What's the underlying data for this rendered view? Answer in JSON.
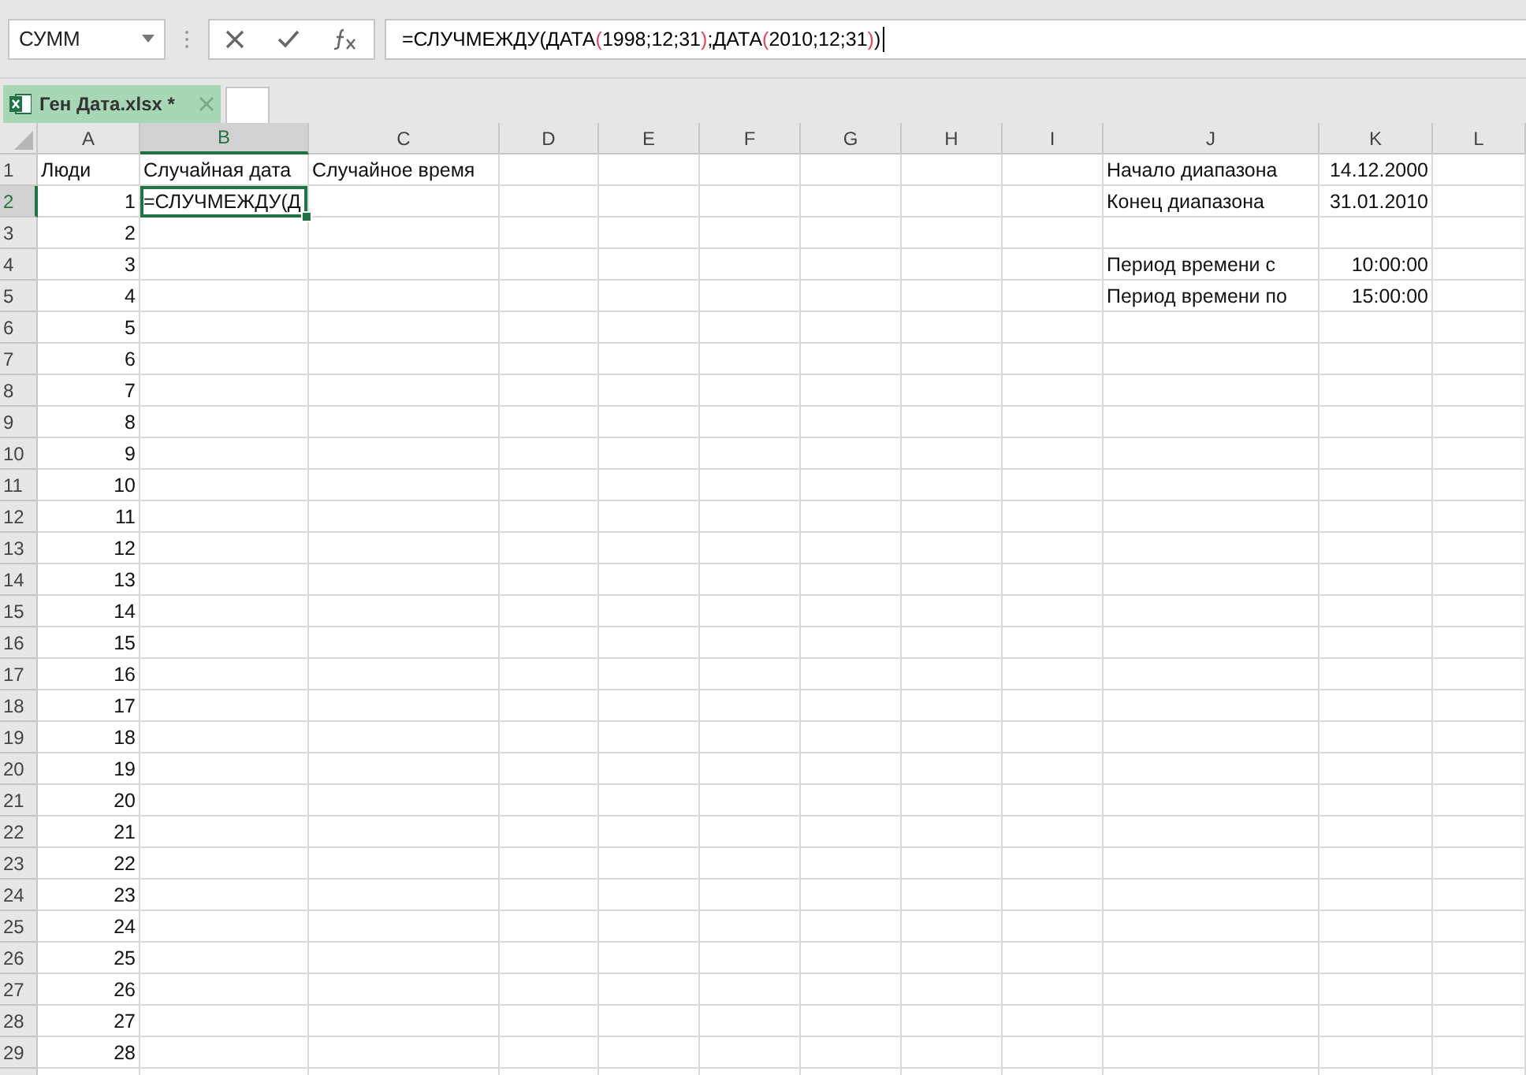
{
  "name_box": {
    "value": "СУММ"
  },
  "formula_bar": {
    "parts": [
      {
        "text": "=СЛУЧМЕЖДУ(ДАТА",
        "color": "#000000"
      },
      {
        "text": "(",
        "color": "#e0475b"
      },
      {
        "text": "1998;12;31",
        "color": "#000000"
      },
      {
        "text": ")",
        "color": "#e0475b"
      },
      {
        "text": ";ДАТА",
        "color": "#000000"
      },
      {
        "text": "(",
        "color": "#e0475b"
      },
      {
        "text": "2010;12;31",
        "color": "#000000"
      },
      {
        "text": ")",
        "color": "#e0475b"
      },
      {
        "text": ")",
        "color": "#000000"
      }
    ]
  },
  "workbook_tab": {
    "title": "Ген Дата.xlsx *"
  },
  "columns": [
    {
      "label": "A",
      "selected": false
    },
    {
      "label": "B",
      "selected": true
    },
    {
      "label": "C",
      "selected": false
    },
    {
      "label": "D",
      "selected": false
    },
    {
      "label": "E",
      "selected": false
    },
    {
      "label": "F",
      "selected": false
    },
    {
      "label": "G",
      "selected": false
    },
    {
      "label": "H",
      "selected": false
    },
    {
      "label": "I",
      "selected": false
    },
    {
      "label": "J",
      "selected": false
    },
    {
      "label": "K",
      "selected": false
    },
    {
      "label": "L",
      "selected": false
    }
  ],
  "rows": [
    {
      "number": "1",
      "selected": false,
      "cells": [
        {
          "text": "Люди",
          "kind": "text"
        },
        {
          "text": "Случайная дата",
          "kind": "text"
        },
        {
          "text": "Случайное время",
          "kind": "text"
        },
        null,
        null,
        null,
        null,
        null,
        null,
        {
          "text": "Начало диапазона",
          "kind": "text"
        },
        {
          "text": "14.12.2000",
          "kind": "number"
        }
      ]
    },
    {
      "number": "2",
      "selected": true,
      "cells": [
        {
          "text": "1",
          "kind": "number"
        },
        {
          "text": "=СЛУЧМЕЖДУ(Д",
          "kind": "text"
        },
        null,
        null,
        null,
        null,
        null,
        null,
        null,
        {
          "text": "Конец диапазона",
          "kind": "text"
        },
        {
          "text": "31.01.2010",
          "kind": "number"
        }
      ]
    },
    {
      "number": "3",
      "selected": false,
      "cells": [
        {
          "text": "2",
          "kind": "number"
        }
      ]
    },
    {
      "number": "4",
      "selected": false,
      "cells": [
        {
          "text": "3",
          "kind": "number"
        },
        null,
        null,
        null,
        null,
        null,
        null,
        null,
        null,
        {
          "text": "Период времени с",
          "kind": "text"
        },
        {
          "text": "10:00:00",
          "kind": "number"
        }
      ]
    },
    {
      "number": "5",
      "selected": false,
      "cells": [
        {
          "text": "4",
          "kind": "number"
        },
        null,
        null,
        null,
        null,
        null,
        null,
        null,
        null,
        {
          "text": "Период времени по",
          "kind": "text"
        },
        {
          "text": "15:00:00",
          "kind": "number"
        }
      ]
    },
    {
      "number": "6",
      "selected": false,
      "cells": [
        {
          "text": "5",
          "kind": "number"
        }
      ]
    },
    {
      "number": "7",
      "selected": false,
      "cells": [
        {
          "text": "6",
          "kind": "number"
        }
      ]
    },
    {
      "number": "8",
      "selected": false,
      "cells": [
        {
          "text": "7",
          "kind": "number"
        }
      ]
    },
    {
      "number": "9",
      "selected": false,
      "cells": [
        {
          "text": "8",
          "kind": "number"
        }
      ]
    },
    {
      "number": "10",
      "selected": false,
      "cells": [
        {
          "text": "9",
          "kind": "number"
        }
      ]
    },
    {
      "number": "11",
      "selected": false,
      "cells": [
        {
          "text": "10",
          "kind": "number"
        }
      ]
    },
    {
      "number": "12",
      "selected": false,
      "cells": [
        {
          "text": "11",
          "kind": "number"
        }
      ]
    },
    {
      "number": "13",
      "selected": false,
      "cells": [
        {
          "text": "12",
          "kind": "number"
        }
      ]
    },
    {
      "number": "14",
      "selected": false,
      "cells": [
        {
          "text": "13",
          "kind": "number"
        }
      ]
    },
    {
      "number": "15",
      "selected": false,
      "cells": [
        {
          "text": "14",
          "kind": "number"
        }
      ]
    },
    {
      "number": "16",
      "selected": false,
      "cells": [
        {
          "text": "15",
          "kind": "number"
        }
      ]
    },
    {
      "number": "17",
      "selected": false,
      "cells": [
        {
          "text": "16",
          "kind": "number"
        }
      ]
    },
    {
      "number": "18",
      "selected": false,
      "cells": [
        {
          "text": "17",
          "kind": "number"
        }
      ]
    },
    {
      "number": "19",
      "selected": false,
      "cells": [
        {
          "text": "18",
          "kind": "number"
        }
      ]
    },
    {
      "number": "20",
      "selected": false,
      "cells": [
        {
          "text": "19",
          "kind": "number"
        }
      ]
    },
    {
      "number": "21",
      "selected": false,
      "cells": [
        {
          "text": "20",
          "kind": "number"
        }
      ]
    },
    {
      "number": "22",
      "selected": false,
      "cells": [
        {
          "text": "21",
          "kind": "number"
        }
      ]
    },
    {
      "number": "23",
      "selected": false,
      "cells": [
        {
          "text": "22",
          "kind": "number"
        }
      ]
    },
    {
      "number": "24",
      "selected": false,
      "cells": [
        {
          "text": "23",
          "kind": "number"
        }
      ]
    },
    {
      "number": "25",
      "selected": false,
      "cells": [
        {
          "text": "24",
          "kind": "number"
        }
      ]
    },
    {
      "number": "26",
      "selected": false,
      "cells": [
        {
          "text": "25",
          "kind": "number"
        }
      ]
    },
    {
      "number": "27",
      "selected": false,
      "cells": [
        {
          "text": "26",
          "kind": "number"
        }
      ]
    },
    {
      "number": "28",
      "selected": false,
      "cells": [
        {
          "text": "27",
          "kind": "number"
        }
      ]
    },
    {
      "number": "29",
      "selected": false,
      "cells": [
        {
          "text": "28",
          "kind": "number"
        }
      ]
    }
  ]
}
